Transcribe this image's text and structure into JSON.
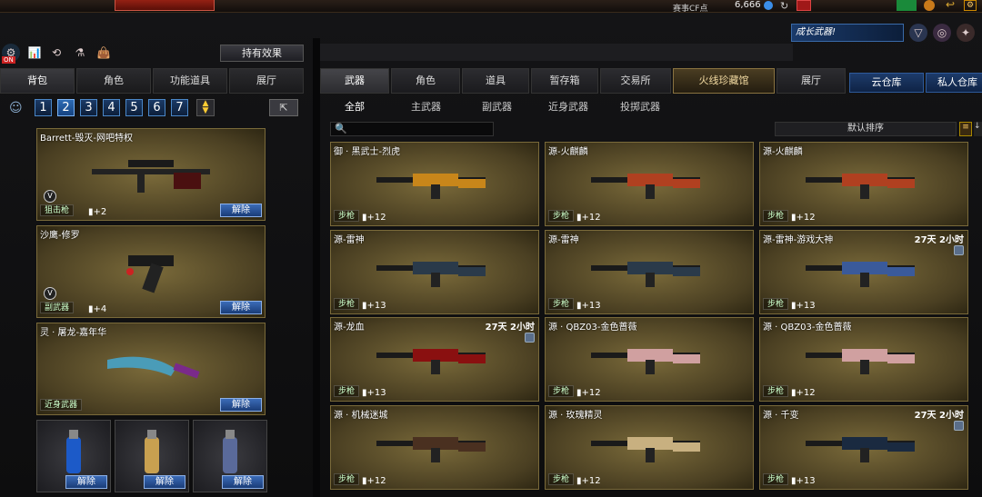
{
  "topbar": {
    "cf_label": "赛事CF点",
    "cf_value": "6,666"
  },
  "left": {
    "effect_button": "持有效果",
    "tabs": [
      "背包",
      "角色",
      "功能道具",
      "展厅"
    ],
    "slots": [
      "1",
      "2",
      "3",
      "4",
      "5",
      "6",
      "7"
    ],
    "active_slot": "2",
    "items": [
      {
        "title": "Barrett-毁灭-网吧特权",
        "category": "狙击枪",
        "bonus": "+2",
        "action": "解除"
      },
      {
        "title": "沙鹰-修罗",
        "category": "副武器",
        "bonus": "+4",
        "action": "解除"
      },
      {
        "title": "灵 · 屠龙-嘉年华",
        "category": "近身武器",
        "bonus": "",
        "action": "解除"
      }
    ],
    "grenades": [
      {
        "action": "解除"
      },
      {
        "action": "解除"
      },
      {
        "action": "解除"
      }
    ]
  },
  "right": {
    "tabs": [
      "武器",
      "角色",
      "道具",
      "暂存箱",
      "交易所",
      "火线珍藏馆",
      "展厅"
    ],
    "cloud_tabs": [
      "云仓库",
      "私人仓库"
    ],
    "subtabs": [
      "全部",
      "主武器",
      "副武器",
      "近身武器",
      "投掷武器"
    ],
    "sort_label": "默认排序",
    "banner_label": "成长武器!",
    "cards": [
      {
        "title": "御 · 黑武士-烈虎",
        "category": "步枪",
        "bonus": "+12",
        "timer": "",
        "locked": false
      },
      {
        "title": "源-火麒麟",
        "category": "步枪",
        "bonus": "+12",
        "timer": "",
        "locked": false
      },
      {
        "title": "源-火麒麟",
        "category": "步枪",
        "bonus": "+12",
        "timer": "",
        "locked": false
      },
      {
        "title": "源-雷神",
        "category": "步枪",
        "bonus": "+13",
        "timer": "",
        "locked": false
      },
      {
        "title": "源-雷神",
        "category": "步枪",
        "bonus": "+13",
        "timer": "",
        "locked": false
      },
      {
        "title": "源-雷神-游戏大神",
        "category": "步枪",
        "bonus": "+13",
        "timer": "27天 2小时",
        "locked": true
      },
      {
        "title": "源-龙血",
        "category": "步枪",
        "bonus": "+13",
        "timer": "27天 2小时",
        "locked": true
      },
      {
        "title": "源 · QBZ03-金色蔷薇",
        "category": "步枪",
        "bonus": "+12",
        "timer": "",
        "locked": false
      },
      {
        "title": "源 · QBZ03-金色蔷薇",
        "category": "步枪",
        "bonus": "+12",
        "timer": "",
        "locked": false
      },
      {
        "title": "源 · 机械迷城",
        "category": "步枪",
        "bonus": "+12",
        "timer": "",
        "locked": false
      },
      {
        "title": "源 · 玫瑰精灵",
        "category": "步枪",
        "bonus": "+12",
        "timer": "",
        "locked": false
      },
      {
        "title": "源 · 千变",
        "category": "步枪",
        "bonus": "+13",
        "timer": "27天 2小时",
        "locked": true
      }
    ]
  }
}
